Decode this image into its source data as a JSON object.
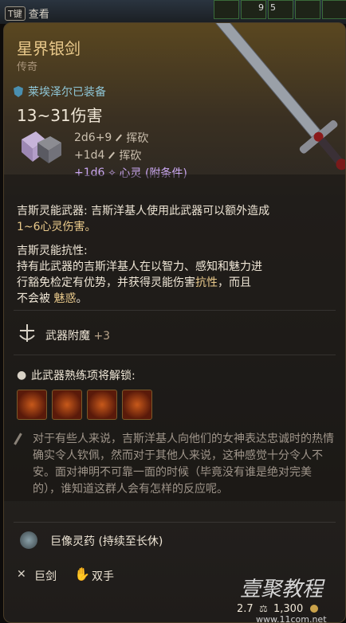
{
  "topbar": {
    "key_label": "T键",
    "view_label": "查看",
    "slot_counts": [
      "9",
      "5"
    ]
  },
  "item": {
    "name": "星界银剑",
    "rarity": "传奇",
    "equipped_text": "莱埃泽尔已装备",
    "damage": "13~31伤害",
    "damage_lines": [
      {
        "dice": "2d6+9",
        "type": "挥砍"
      },
      {
        "dice": "+1d4",
        "type": "挥砍"
      },
      {
        "dice": "+1d6",
        "type": "心灵 (附条件)"
      }
    ]
  },
  "desc1": {
    "title": "吉斯灵能武器:",
    "body": "吉斯洋基人使用此武器可以额外造成",
    "highlight": "1~6心灵伤害。"
  },
  "desc2": {
    "title": "吉斯灵能抗性:",
    "line1": "持有此武器的吉斯洋基人在以智力、感知和魅力进",
    "line2a": "行豁免检定有优势，并获得灵能伤害",
    "line2b": "抗性",
    "line2c": "，而且",
    "line3a": "不会被 ",
    "line3b": "魅惑",
    "line3c": "。"
  },
  "enchant": {
    "label": "武器附魔",
    "value": "+3"
  },
  "proficiency": {
    "label": "此武器熟练项将解锁:"
  },
  "flavor": "对于有些人来说，吉斯洋基人向他们的女神表达忠诚时的热情确实令人钦佩，然而对于其他人来说，这种感觉十分令人不安。面对神明不可靠一面的时候（毕竟没有谁是绝对完美的），谁知道这群人会有怎样的反应呢。",
  "elixir": "巨像灵药 (持续至长休)",
  "footer": {
    "weapon_type": "巨剑",
    "handed": "双手",
    "weight": "2.7",
    "price": "1,300"
  },
  "watermark": {
    "line1": "壹聚教程",
    "line2": "www.11com.net"
  }
}
